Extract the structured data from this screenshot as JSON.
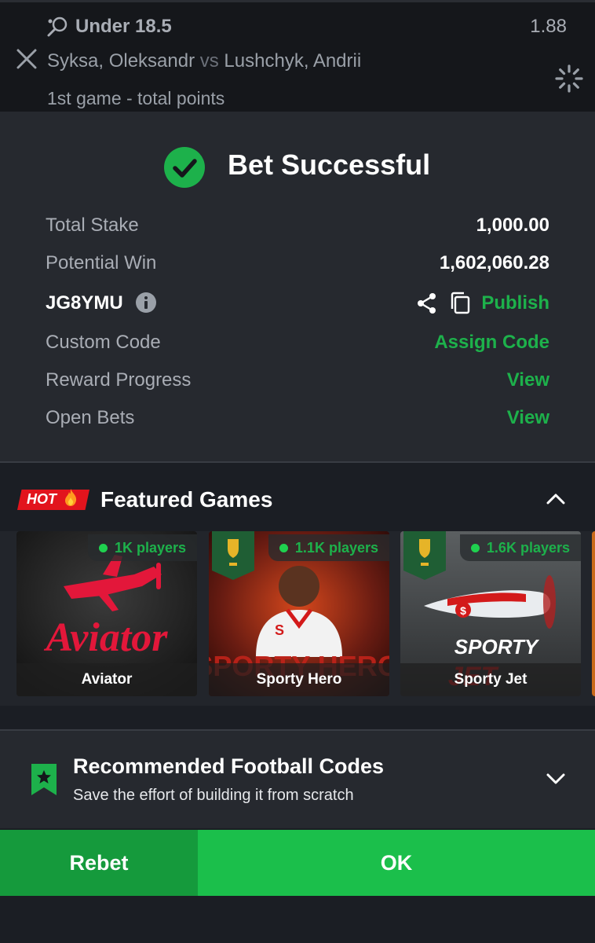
{
  "bet_line": {
    "selection": "Under 18.5",
    "odds": "1.88",
    "home": "Syksa, Oleksandr",
    "vs": "vs",
    "away": "Lushchyk, Andrii",
    "market": "1st game - total points"
  },
  "result": {
    "title": "Bet Successful",
    "rows": [
      {
        "label": "Total Stake",
        "value": "1,000.00"
      },
      {
        "label": "Potential Win",
        "value": "1,602,060.28"
      }
    ],
    "booking_code": "JG8YMU",
    "publish_label": "Publish",
    "custom_code_label": "Custom Code",
    "assign_code_label": "Assign Code",
    "reward_progress_label": "Reward Progress",
    "reward_view_label": "View",
    "open_bets_label": "Open Bets",
    "open_bets_view_label": "View"
  },
  "featured": {
    "badge": "HOT",
    "title": "Featured Games",
    "games": [
      {
        "name": "Aviator",
        "players": "1K players"
      },
      {
        "name": "Sporty Hero",
        "players": "1.1K players"
      },
      {
        "name": "Sporty Jet",
        "players": "1.6K players"
      }
    ]
  },
  "recommended": {
    "title": "Recommended Football Codes",
    "subtitle": "Save the effort of building it from scratch"
  },
  "buttons": {
    "rebet": "Rebet",
    "ok": "OK"
  },
  "colors": {
    "accent_green": "#1db14b",
    "ok_button": "#1bbf4b",
    "rebet_button": "#159a3c",
    "hot_red": "#e2141d",
    "panel_bg": "#26292f"
  },
  "icons": [
    "ping-pong-icon",
    "close-icon",
    "spinner-icon",
    "check-circle-icon",
    "info-icon",
    "share-icon",
    "copy-icon",
    "flame-icon",
    "chevron-up-icon",
    "bookmark-star-icon",
    "chevron-down-icon"
  ]
}
